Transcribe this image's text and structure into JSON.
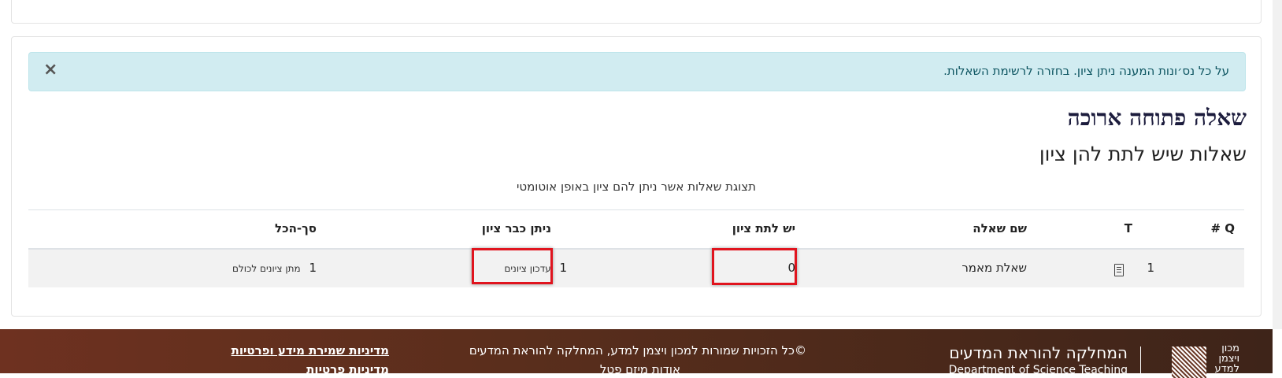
{
  "alert": {
    "message": "על כל נס׳ונות המענה ניתן ציון. בחזרה לרשימת השאלות.",
    "close_glyph": "×"
  },
  "page_title": "שאלה פתוחה ארוכה",
  "section_title": "שאלות שיש לתת להן ציון",
  "table_caption": "תצוגת שאלות אשר ניתן להם ציון באופן אוטומטי",
  "table": {
    "headers": {
      "q_number": "Q #",
      "type": "T",
      "question_name": "שם שאלה",
      "to_grade": "יש לתת ציון",
      "already_graded": "ניתן כבר ציון",
      "total": "סך-הכל"
    },
    "rows": [
      {
        "q_number": "1",
        "type_icon": "document-icon",
        "question_name": "שאלת מאמר",
        "to_grade": "0",
        "already_graded_count": "1",
        "already_graded_link": "עדכון ציונים",
        "total_count": "1",
        "total_link": "מתן ציונים לכולם"
      }
    ]
  },
  "footer": {
    "copyright": "©כל הזכויות שמורות למכון ויצמן למדע, המחלקה להוראת המדעים",
    "about_site": "אודות מיזם פטל",
    "privacy_policy_link": "מדיניות שמירת מידע ופרטיות",
    "privacy_link": "מדיניות פרטיות",
    "dept_name_he": "המחלקה להוראת המדעים",
    "dept_name_en": "Department of Science Teaching",
    "logo_text_he": "מכון ויצמן למדע"
  },
  "colors": {
    "alert_bg": "#d1ecf1",
    "alert_text": "#0c5460",
    "highlight": "#e0141e",
    "footer_bg": "#5a2e1c"
  }
}
